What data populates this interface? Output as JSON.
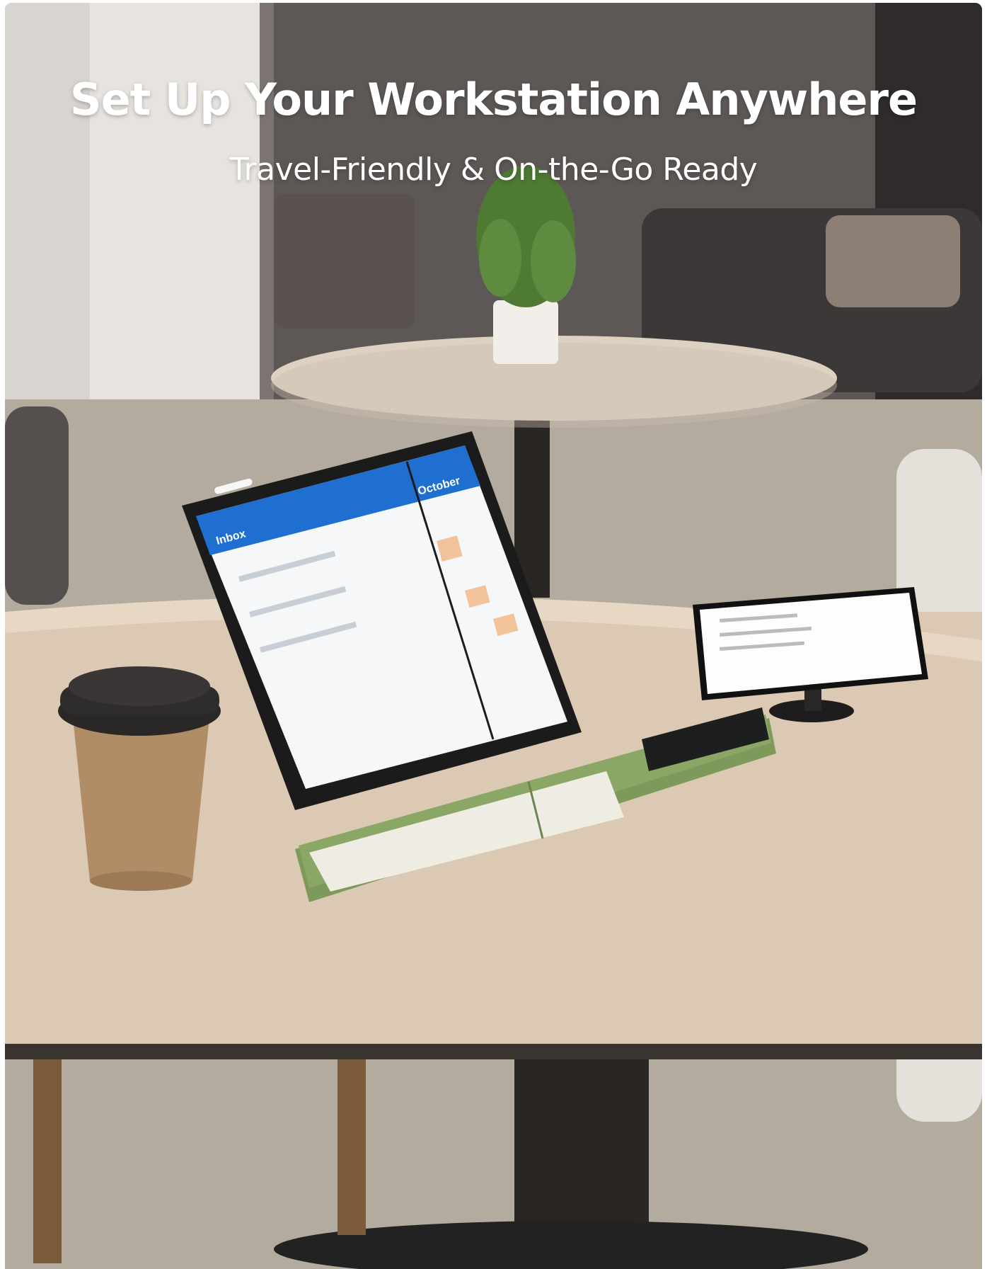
{
  "hero": {
    "title": "Set Up Your Workstation Anywhere",
    "subtitle": "Travel-Friendly & On-the-Go Ready"
  },
  "tablet_screen": {
    "left_title": "Inbox",
    "right_title": "October"
  },
  "colors": {
    "keyboard_green": "#7e9a5b",
    "key_white": "#f1efe7",
    "table_top": "#dcc9b3",
    "tablet_blue": "#1f6fd1"
  },
  "icons": [
    "coffee-cup",
    "tablet",
    "keyboard",
    "phone-stand"
  ]
}
